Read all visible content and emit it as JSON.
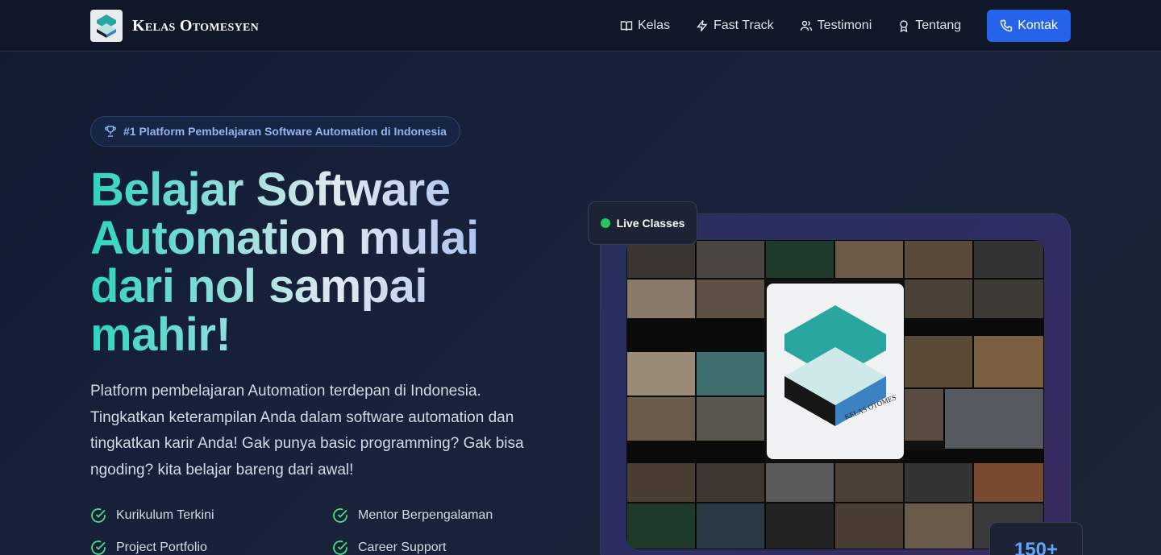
{
  "brand": {
    "name": "Kelas Otomesyen",
    "logo_text": "KELAS OTOMESYEN"
  },
  "nav": {
    "items": [
      {
        "label": "Kelas",
        "icon": "book-icon"
      },
      {
        "label": "Fast Track",
        "icon": "lightning-icon"
      },
      {
        "label": "Testimoni",
        "icon": "users-icon"
      },
      {
        "label": "Tentang",
        "icon": "award-icon"
      }
    ],
    "cta": {
      "label": "Kontak",
      "icon": "phone-icon"
    }
  },
  "hero": {
    "badge": "#1 Platform Pembelajaran Software Automation di Indonesia",
    "headline_lines": [
      "Belajar Software",
      "Automation mulai",
      "dari nol sampai",
      "mahir!"
    ],
    "description": "Platform pembelajaran Automation terdepan di Indonesia. Tingkatkan keterampilan Anda dalam software automation dan tingkatkan karir Anda! Gak punya basic programming? Gak bisa ngoding? kita belajar bareng dari awal!",
    "features": [
      "Kurikulum Terkini",
      "Mentor Berpengalaman",
      "Project Portfolio",
      "Career Support"
    ]
  },
  "media": {
    "live_label": "Live Classes",
    "stat_value": "150+"
  },
  "colors": {
    "accent": "#2563eb",
    "teal": "#2dd4bf",
    "check": "#4ade80",
    "live": "#22c55e"
  }
}
